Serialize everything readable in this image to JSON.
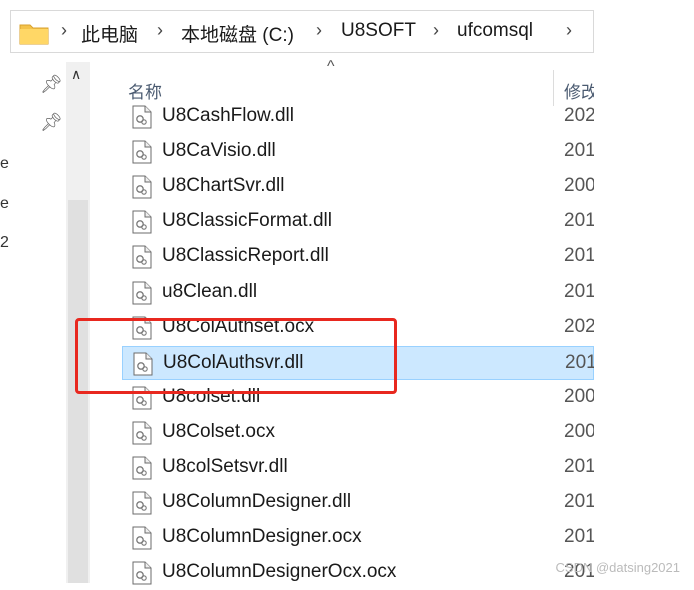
{
  "breadcrumb": [
    "此电脑",
    "本地磁盘 (C:)",
    "U8SOFT",
    "ufcomsql"
  ],
  "columns": {
    "name": "名称",
    "modified": "修改"
  },
  "nav_fragments": [
    "e",
    "e",
    "2"
  ],
  "files": [
    {
      "name": "U8CashFlow.dll",
      "date": "202"
    },
    {
      "name": "U8CaVisio.dll",
      "date": "201"
    },
    {
      "name": "U8ChartSvr.dll",
      "date": "200"
    },
    {
      "name": "U8ClassicFormat.dll",
      "date": "201"
    },
    {
      "name": "U8ClassicReport.dll",
      "date": "201"
    },
    {
      "name": "u8Clean.dll",
      "date": "201"
    },
    {
      "name": "U8ColAuthset.ocx",
      "date": "202"
    },
    {
      "name": "U8ColAuthsvr.dll",
      "date": "201",
      "selected": true
    },
    {
      "name": "U8colset.dll",
      "date": "200"
    },
    {
      "name": "U8Colset.ocx",
      "date": "200"
    },
    {
      "name": "U8colSetsvr.dll",
      "date": "201"
    },
    {
      "name": "U8ColumnDesigner.dll",
      "date": "201"
    },
    {
      "name": "U8ColumnDesigner.ocx",
      "date": "201"
    },
    {
      "name": "U8ColumnDesignerOcx.ocx",
      "date": "201"
    }
  ],
  "watermark": "CSDN @datsing2021",
  "colors": {
    "selected_bg": "#cce8ff",
    "highlight_box": "#e8281f",
    "folder": "#f4c34b"
  }
}
